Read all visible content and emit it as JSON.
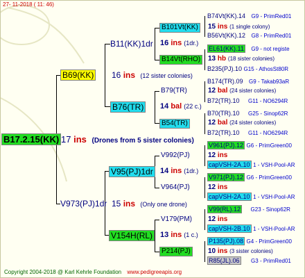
{
  "header": {
    "date": "27-  11-2018  ( 11:  46)"
  },
  "root": {
    "id": "B17.2.15(KK)",
    "count": "17",
    "unit": "ins",
    "note": "(Drones from 5 sister colonies)"
  },
  "gen1": [
    {
      "id": "B69(KK)",
      "count": "16",
      "unit": "ins",
      "note": "(12 sister colonies)"
    },
    {
      "id": "V973(PJ)1dr",
      "count": "15",
      "unit": "ins",
      "note": "(Only one drone)"
    }
  ],
  "gen2": [
    {
      "id": "B11(KK)1dr",
      "count": "16",
      "unit": "ins",
      "note": "(1dr.)"
    },
    {
      "id": "B76(TR)",
      "count": "14",
      "unit": "bal",
      "note": "(22 c.)"
    },
    {
      "id": "V95(PJ)1dr",
      "count": "14",
      "unit": "ins",
      "note": "(1dr.)"
    },
    {
      "id": "V154H(RL)",
      "count": "13",
      "unit": "ins",
      "note": "(1 c.)"
    }
  ],
  "gen3": [
    {
      "id": "B101Vt(KK)",
      "count": "15",
      "unit": "ins",
      "note": "(1 single colony)"
    },
    {
      "id": "B14Vt(RHO)",
      "count": "13",
      "unit": "hb",
      "note": "(18 sister colonies)"
    },
    {
      "id": "B79(TR)",
      "count": "12",
      "unit": "bal",
      "note": "(24 sister colonies)"
    },
    {
      "id": "B54(TR)",
      "count": "12",
      "unit": "bal",
      "note": "(24 sister colonies)"
    },
    {
      "id": "V992(PJ)",
      "count": "12",
      "unit": "ins",
      "note": ""
    },
    {
      "id": "V964(PJ)",
      "count": "12",
      "unit": "ins",
      "note": ""
    },
    {
      "id": "V179(PM)",
      "count": "12",
      "unit": "ins",
      "note": ""
    },
    {
      "id": "P214(PJ)",
      "count": "10",
      "unit": "ins",
      "note": "(3 sister colonies)"
    }
  ],
  "gen4": [
    {
      "id": "B74Vt(KK).14",
      "info": "G9 - PrimRed01"
    },
    {
      "id": "B56Vt(KK).12",
      "info": "G8 - PrimRed01"
    },
    {
      "id": "EL61(KK).11",
      "info": "G9 - not registe"
    },
    {
      "id": "B235(PJ).10",
      "info": "G15 - AthosSt80R"
    },
    {
      "id": "B174(TR).09",
      "info": "G9 - Takab93aR"
    },
    {
      "id": "B72(TR).10",
      "info": "G11 - NO6294R"
    },
    {
      "id": "B70(TR).10",
      "info": "G25 - Sinop62R"
    },
    {
      "id": "B72(TR).10",
      "info": "G11 - NO6294R"
    },
    {
      "id": "V961(PJ).12",
      "info": "G6 - PrimGreen00"
    },
    {
      "id": "capVSH-2A.10",
      "info": "1 - VSH-Pool-AR"
    },
    {
      "id": "V971(PJ).12",
      "info": "G6 - PrimGreen00"
    },
    {
      "id": "capVSH-2A.10",
      "info": "1 - VSH-Pool-AR"
    },
    {
      "id": "V99(RL).12",
      "info": "G23 - Sinop62R"
    },
    {
      "id": "capVSH-2B.10",
      "info": "1 - VSH-Pool-AR"
    },
    {
      "id": "P135(PJ).08",
      "info": "G4 - PrimGreen00"
    },
    {
      "id": "R85(JL).06",
      "info": "G3 - PrimRed01"
    }
  ],
  "footer": {
    "copyright": "Copyright 2004-2018 @ Karl Kehrle Foundation",
    "site": "www.pedigreeapis.org"
  }
}
